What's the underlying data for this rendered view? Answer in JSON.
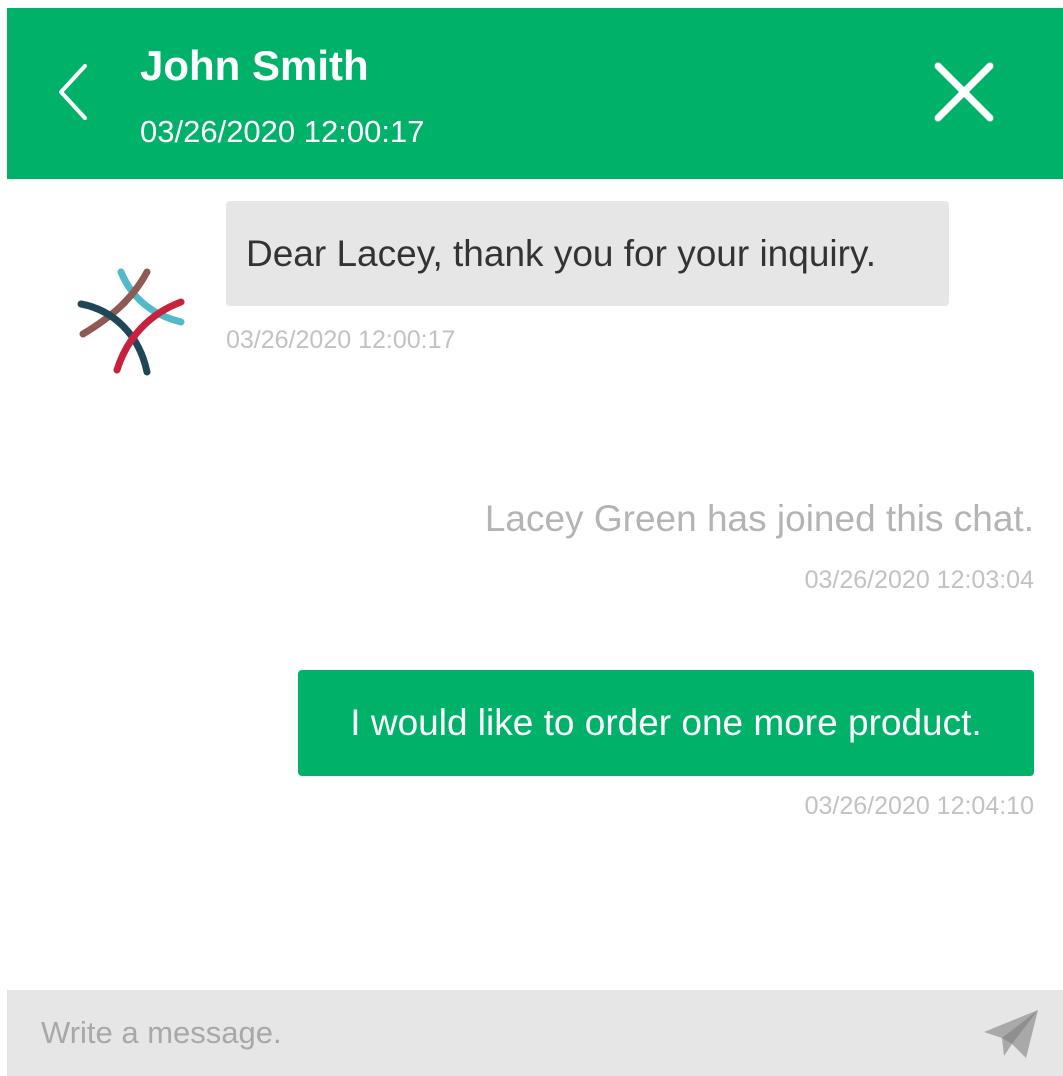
{
  "header": {
    "name": "John Smith",
    "timestamp": "03/26/2020 12:00:17",
    "back_icon": "chevron-left-icon",
    "close_icon": "close-icon",
    "background_color": "#00b16a"
  },
  "messages": [
    {
      "type": "incoming",
      "text": "Dear Lacey, thank you for your inquiry.",
      "timestamp": "03/26/2020 12:00:17",
      "avatar_icon": "agent-logo-icon"
    },
    {
      "type": "system",
      "text": "Lacey Green has joined this chat.",
      "timestamp": "03/26/2020 12:03:04"
    },
    {
      "type": "outgoing",
      "text": "I would like to order one more product.",
      "timestamp": "03/26/2020 12:04:10"
    }
  ],
  "composer": {
    "placeholder": "Write a message.",
    "value": "",
    "send_icon": "paper-plane-icon"
  },
  "colors": {
    "accent": "#00b16a",
    "incoming_bubble": "#e6e6e6",
    "timestamp": "#c2c2c2"
  }
}
